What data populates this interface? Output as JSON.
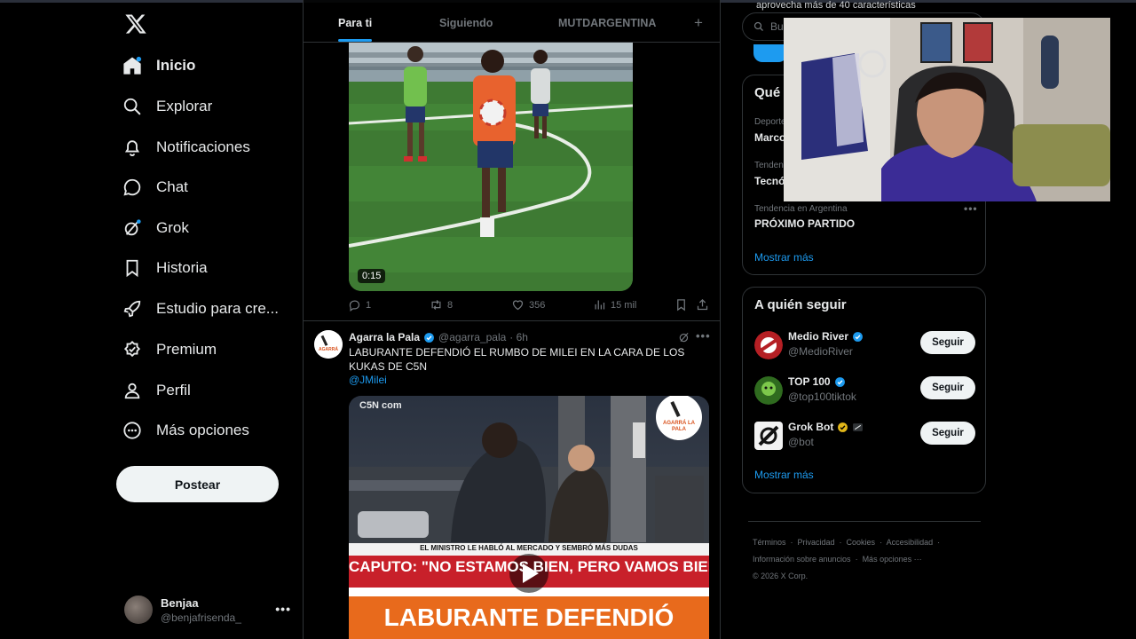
{
  "app": {
    "name": "X"
  },
  "nav": {
    "items": [
      {
        "label": "Inicio",
        "icon": "home-icon"
      },
      {
        "label": "Explorar",
        "icon": "search-icon"
      },
      {
        "label": "Notificaciones",
        "icon": "bell-icon"
      },
      {
        "label": "Chat",
        "icon": "chat-icon"
      },
      {
        "label": "Grok",
        "icon": "grok-icon"
      },
      {
        "label": "Historia",
        "icon": "bookmark-icon"
      },
      {
        "label": "Estudio para cre...",
        "icon": "rocket-icon"
      },
      {
        "label": "Premium",
        "icon": "premium-icon"
      },
      {
        "label": "Perfil",
        "icon": "user-icon"
      },
      {
        "label": "Más opciones",
        "icon": "more-circle-icon"
      }
    ],
    "post_button": "Postear"
  },
  "account": {
    "name": "Benjaa",
    "handle": "@benjafrisenda_",
    "more": "•••"
  },
  "tabs": {
    "items": [
      "Para ti",
      "Siguiendo",
      "MUTDARGENTINA"
    ],
    "plus": "+"
  },
  "post1": {
    "duration": "0:15",
    "replies": "1",
    "reposts": "8",
    "likes": "356",
    "views": "15 mil"
  },
  "post2": {
    "avatar_text": "AGARRÁ LA PALA",
    "name": "Agarra la Pala",
    "handle": "@agarra_pala",
    "time": "· 6h",
    "more": "•••",
    "text": "LABURANTE DEFENDIÓ EL RUMBO DE MILEI EN LA CARA DE LOS KUKAS DE C5N",
    "mention": "@JMilei",
    "video": {
      "watermark": "C5N com",
      "logo_text": "AGARRÁ LA PALA",
      "ticker": "EL MINISTRO LE HABLÓ AL MERCADO Y SEMBRÓ MÁS DUDAS",
      "headline": "CAPUTO: \"NO ESTAMOS BIEN, PERO VAMOS BIEN\"",
      "banner": "LABURANTE DEFENDIÓ"
    }
  },
  "right": {
    "promo_text": "aprovecha más de 40 características",
    "search_placeholder": "Buscar",
    "trends": {
      "title": "Qué está pasando",
      "items": [
        {
          "context": "Deportes · Tendencia",
          "name": "Marcos"
        },
        {
          "context": "Tendencia en Argentina",
          "name": "Tecnó"
        },
        {
          "context": "Tendencia en Argentina",
          "name": "PRÓXIMO PARTIDO"
        }
      ],
      "show_more": "Mostrar más",
      "more": "•••"
    },
    "who_to_follow": {
      "title": "A quién seguir",
      "items": [
        {
          "name": "Medio River",
          "handle": "@MedioRiver",
          "verified": "blue",
          "button": "Seguir"
        },
        {
          "name": "TOP 100",
          "handle": "@top100tiktok",
          "verified": "blue",
          "button": "Seguir"
        },
        {
          "name": "Grok Bot",
          "handle": "@bot",
          "verified": "gold",
          "button": "Seguir"
        }
      ],
      "show_more": "Mostrar más"
    },
    "footer": {
      "links": [
        "Términos",
        "Privacidad",
        "Cookies",
        "Accesibilidad",
        "Información sobre anuncios",
        "Más opciones ···"
      ],
      "copyright": "© 2026 X Corp."
    }
  },
  "colors": {
    "accent": "#1d9bf0",
    "background": "#000000",
    "text": "#e7e9ea",
    "muted": "#71767b",
    "border": "#2f3336",
    "gold": "#e2b719"
  }
}
